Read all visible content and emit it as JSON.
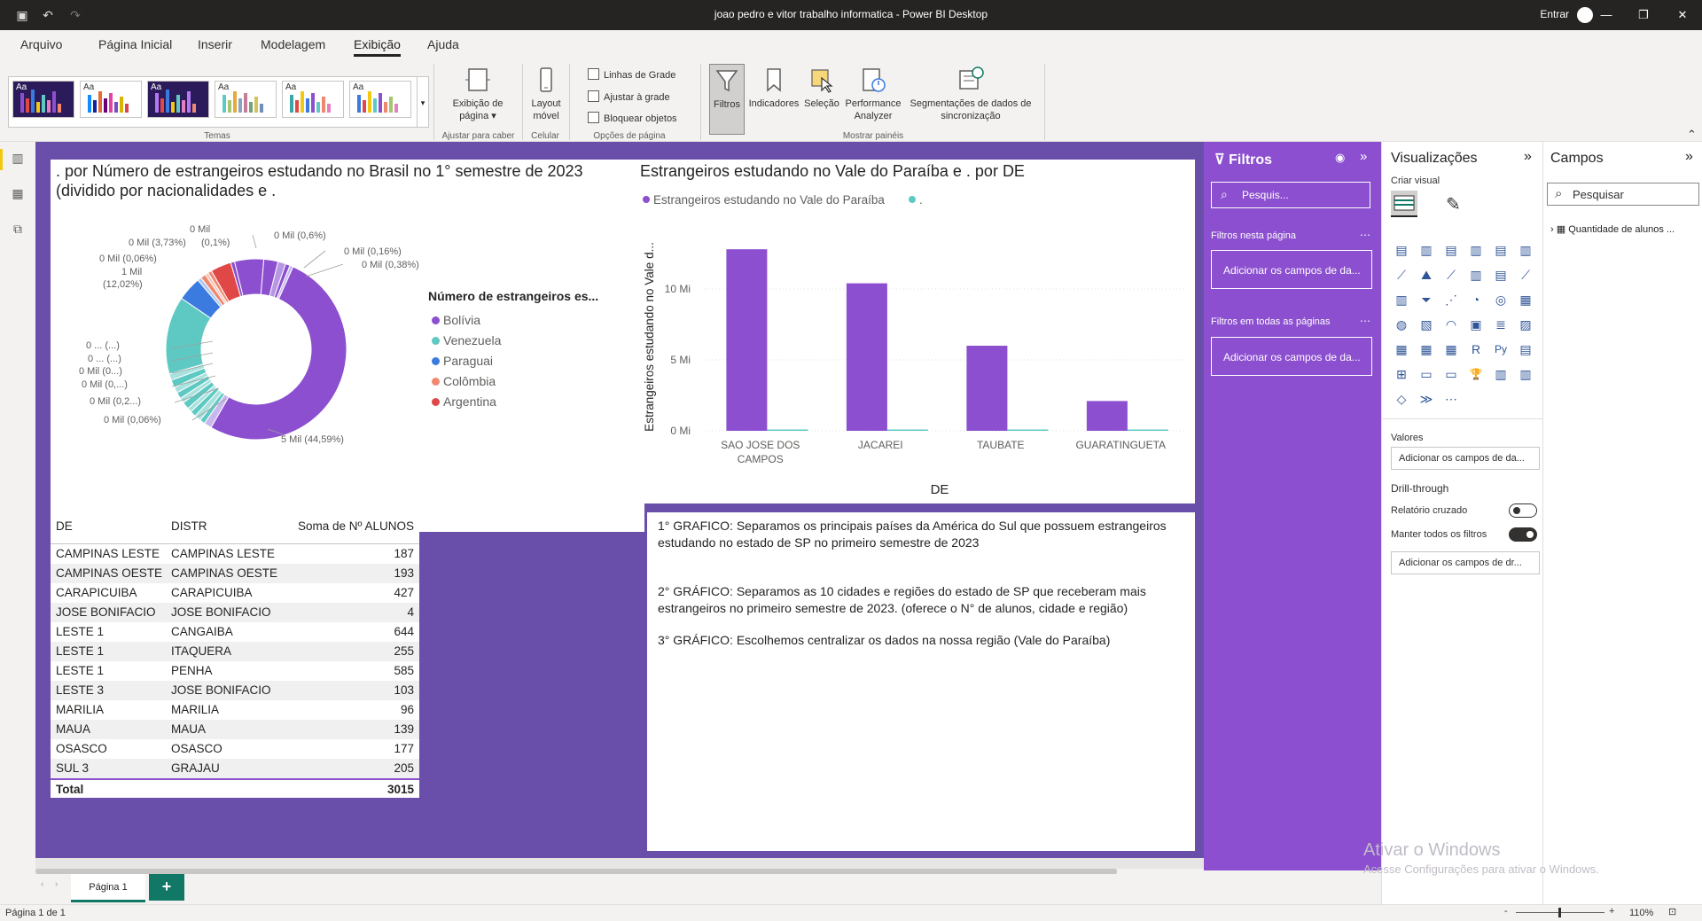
{
  "titlebar": {
    "title": "joao pedro e vitor trabalho informatica - Power BI Desktop",
    "signin": "Entrar"
  },
  "menu": [
    "Arquivo",
    "Página Inicial",
    "Inserir",
    "Modelagem",
    "Exibição",
    "Ajuda"
  ],
  "ribbon": {
    "groups": {
      "themes": "Temas",
      "fit": "Ajustar para caber",
      "mobile": "Celular",
      "page_options": "Opções de página",
      "show_panes": "Mostrar painéis"
    },
    "page_view": "Exibição de página",
    "mobile_layout": [
      "Layout",
      "móvel"
    ],
    "checkboxes": [
      "Linhas de Grade",
      "Ajustar à grade",
      "Bloquear objetos"
    ],
    "panes": [
      "Filtros",
      "Indicadores",
      "Seleção",
      "Performance Analyzer",
      "Segmentações de dados de sincronização"
    ]
  },
  "donut": {
    "title_line1": ". por Número de estrangeiros estudando no Brasil no 1° semestre de 2023",
    "title_line2": "(dividido por nacionalidades e .",
    "legend_title": "Número de estrangeiros es...",
    "legend": [
      {
        "name": "Bolívia",
        "color": "#8b4fcf"
      },
      {
        "name": "Venezuela",
        "color": "#5ec9c3"
      },
      {
        "name": "Paraguai",
        "color": "#3b7be0"
      },
      {
        "name": "Colômbia",
        "color": "#f08870"
      },
      {
        "name": "Argentina",
        "color": "#e04848"
      }
    ],
    "labels": [
      "0 Mil",
      "0 Mil (3,73%)",
      "(0,1%)",
      "0 Mil (0,6%)",
      "0 Mil (0,16%)",
      "0 Mil (0,38%)",
      "0 Mil (0,06%)",
      "1 Mil",
      "(12,02%)",
      "0 ... (...)",
      "0 ... (...)",
      "0 Mil (0...)",
      "0 Mil (0,...)",
      "0 Mil (0,2...)",
      "0 Mil (0,06%)",
      "5 Mil (44,59%)"
    ]
  },
  "chart_data": {
    "type": "bar",
    "title": "Estrangeiros estudando no Vale do Paraíba e . por DE",
    "xlabel": "DE",
    "ylabel": "Estrangeiros estudando no Vale d...",
    "categories": [
      "SAO JOSE DOS CAMPOS",
      "JACAREI",
      "TAUBATE",
      "GUARATINGUETA"
    ],
    "series": [
      {
        "name": "Estrangeiros estudando no Vale do Paraíba",
        "color": "#8b4fcf",
        "values": [
          12.8,
          10.4,
          6.0,
          2.1
        ]
      },
      {
        "name": ".",
        "color": "#5ec9c3",
        "values": [
          0,
          0,
          0,
          0
        ]
      }
    ],
    "yticks": [
      "0 Mi",
      "5 Mi",
      "10 Mi"
    ],
    "ylim": [
      0,
      14
    ]
  },
  "table": {
    "headers": [
      "DE",
      "DISTR",
      "Soma de Nº ALUNOS"
    ],
    "rows": [
      [
        "CAMPINAS LESTE",
        "CAMPINAS LESTE",
        "187"
      ],
      [
        "CAMPINAS OESTE",
        "CAMPINAS OESTE",
        "193"
      ],
      [
        "CARAPICUIBA",
        "CARAPICUIBA",
        "427"
      ],
      [
        "JOSE BONIFACIO",
        "JOSE BONIFACIO",
        "4"
      ],
      [
        "LESTE 1",
        "CANGAIBA",
        "644"
      ],
      [
        "LESTE 1",
        "ITAQUERA",
        "255"
      ],
      [
        "LESTE 1",
        "PENHA",
        "585"
      ],
      [
        "LESTE 3",
        "JOSE BONIFACIO",
        "103"
      ],
      [
        "MARILIA",
        "MARILIA",
        "96"
      ],
      [
        "MAUA",
        "MAUA",
        "139"
      ],
      [
        "OSASCO",
        "OSASCO",
        "177"
      ],
      [
        "SUL 3",
        "GRAJAU",
        "205"
      ]
    ],
    "total_label": "Total",
    "total_value": "3015"
  },
  "textbox": {
    "p1": "1° GRAFICO: Separamos os principais países da América do Sul que possuem estrangeiros estudando no estado de SP no primeiro semestre de 2023",
    "p2": "2° GRÁFICO: Separamos as 10 cidades e regiões do estado de SP que receberam mais estrangeiros no primeiro semestre de 2023. (oferece o N° de alunos, cidade e região)",
    "p3": "3° GRÁFICO: Escolhemos centralizar os dados na nossa região (Vale do Paraíba)"
  },
  "filters": {
    "title": "Filtros",
    "search_placeholder": "Pesquis...",
    "on_page": "Filtros nesta página",
    "all_pages": "Filtros em todas as páginas",
    "add_fields": "Adicionar os campos de da..."
  },
  "viz": {
    "title": "Visualizações",
    "build": "Criar visual",
    "values": "Valores",
    "add_fields": "Adicionar os campos de da...",
    "drill": "Drill-through",
    "cross_report": "Relatório cruzado",
    "keep_filters": "Manter todos os filtros",
    "add_drill": "Adicionar os campos de dr..."
  },
  "fields": {
    "title": "Campos",
    "search_placeholder": "Pesquisar",
    "table_name": "Quantidade de alunos ..."
  },
  "pages": {
    "tab": "Página 1",
    "add": "+"
  },
  "status": {
    "page": "Página 1 de 1",
    "zoom": "110%"
  },
  "watermark": {
    "line1": "Ativar o Windows",
    "line2": "Acesse Configurações para ativar o Windows."
  }
}
